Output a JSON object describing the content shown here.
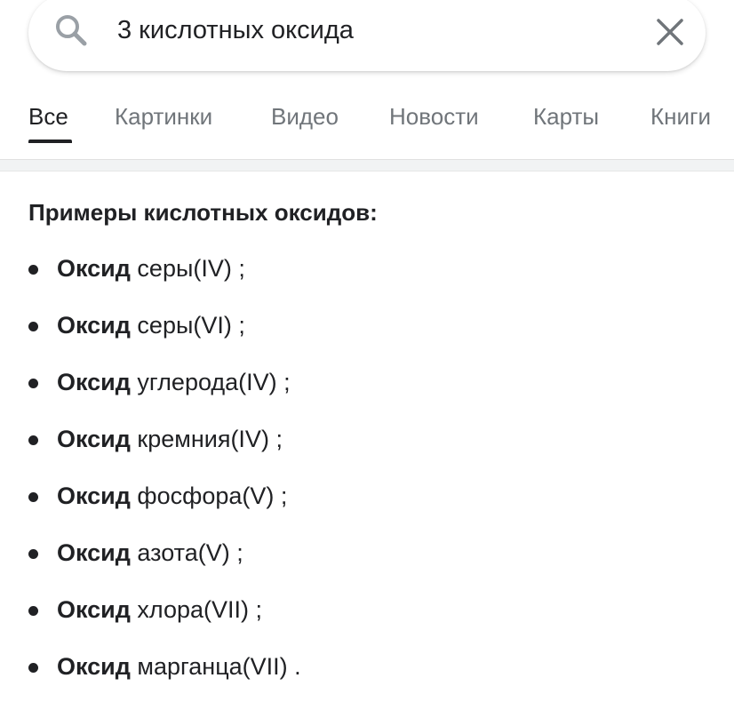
{
  "search": {
    "query": "3 кислотных оксида",
    "search_icon": "search-icon",
    "clear_icon": "close-icon"
  },
  "tabs": [
    {
      "label": "Все",
      "active": true
    },
    {
      "label": "Картинки",
      "active": false
    },
    {
      "label": "Видео",
      "active": false
    },
    {
      "label": "Новости",
      "active": false
    },
    {
      "label": "Карты",
      "active": false
    },
    {
      "label": "Книги",
      "active": false
    }
  ],
  "content": {
    "heading": "Примеры кислотных оксидов:",
    "items": [
      {
        "bold": "Оксид",
        "rest": " серы(IV) ;"
      },
      {
        "bold": "Оксид",
        "rest": " серы(VI) ;"
      },
      {
        "bold": "Оксид",
        "rest": " углерода(IV) ;"
      },
      {
        "bold": "Оксид",
        "rest": " кремния(IV) ;"
      },
      {
        "bold": "Оксид",
        "rest": " фосфора(V) ;"
      },
      {
        "bold": "Оксид",
        "rest": " азота(V) ;"
      },
      {
        "bold": "Оксид",
        "rest": " хлора(VII) ;"
      },
      {
        "bold": "Оксид",
        "rest": " марганца(VII) ."
      }
    ]
  },
  "colors": {
    "text": "#202124",
    "muted": "#70757a",
    "divider": "#f1f3f4"
  }
}
